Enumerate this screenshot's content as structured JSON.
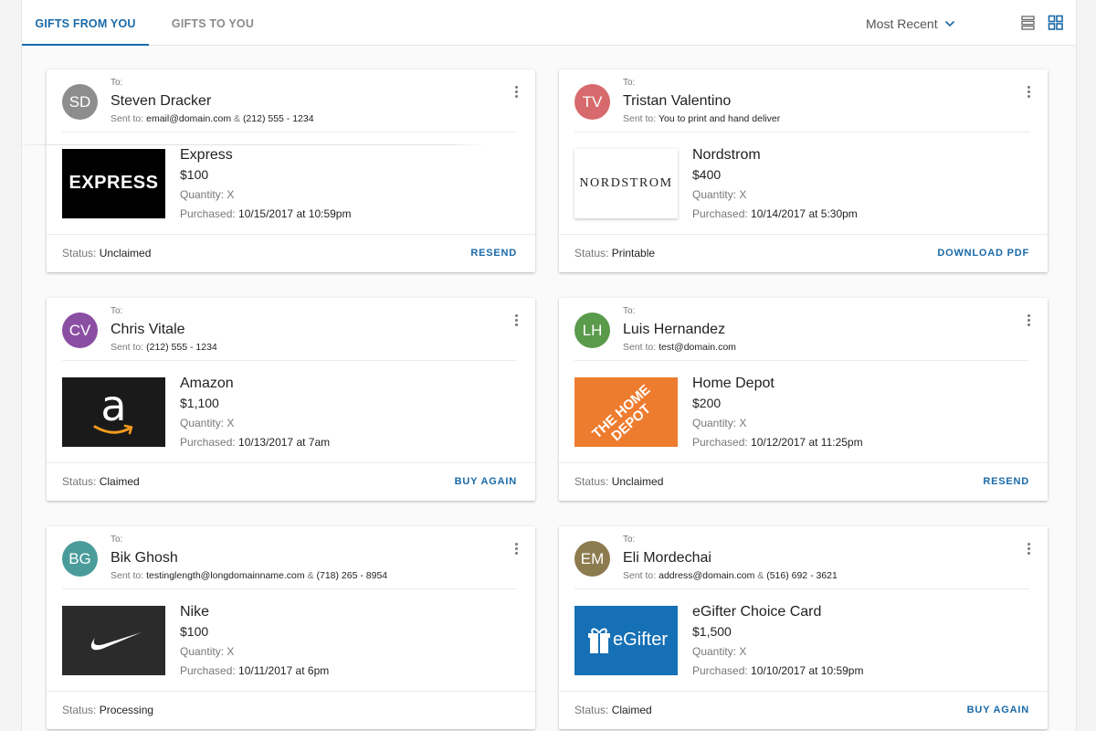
{
  "tabs": [
    {
      "label": "GIFTS FROM YOU",
      "active": true
    },
    {
      "label": "GIFTS TO YOU",
      "active": false
    }
  ],
  "sort": {
    "label": "Most Recent"
  },
  "view_toggle": {
    "list_icon": "list-view-icon",
    "grid_icon": "grid-view-icon",
    "active": "grid"
  },
  "colors": {
    "accent": "#1a6aa8"
  },
  "cards": [
    {
      "initials": "SD",
      "avatar_color": "#8d8d8d",
      "to_label": "To:",
      "name": "Steven Dracker",
      "sent_label": "Sent to:",
      "sent_value": "email@domain.com",
      "sent_sep": "&",
      "sent_value2": "(212) 555 - 1234",
      "brand": "Express",
      "amount": "$100",
      "qty_label": "Quantity:",
      "qty_value": "X",
      "purchased_label": "Purchased:",
      "purchased_value": "10/15/2017 at 10:59pm",
      "logo_text": "EXPRESS",
      "status_label": "Status:",
      "status_value": "Unclaimed",
      "action": "RESEND"
    },
    {
      "initials": "TV",
      "avatar_color": "#d76a6c",
      "to_label": "To:",
      "name": "Tristan Valentino",
      "sent_label": "Sent to:",
      "sent_value": "You to print and hand deliver",
      "sent_sep": "",
      "sent_value2": "",
      "brand": "Nordstrom",
      "amount": "$400",
      "qty_label": "Quantity:",
      "qty_value": "X",
      "purchased_label": "Purchased:",
      "purchased_value": "10/14/2017 at 5:30pm",
      "logo_text": "NORDSTROM",
      "status_label": "Status:",
      "status_value": "Printable",
      "action": "DOWNLOAD PDF"
    },
    {
      "initials": "CV",
      "avatar_color": "#8a4ea3",
      "to_label": "To:",
      "name": "Chris Vitale",
      "sent_label": "Sent to:",
      "sent_value": "(212) 555 - 1234",
      "sent_sep": "",
      "sent_value2": "",
      "brand": "Amazon",
      "amount": "$1,100",
      "qty_label": "Quantity:",
      "qty_value": "X",
      "purchased_label": "Purchased:",
      "purchased_value": "10/13/2017 at 7am",
      "logo_text": "a",
      "status_label": "Status:",
      "status_value": "Claimed",
      "action": "BUY AGAIN"
    },
    {
      "initials": "LH",
      "avatar_color": "#5a9a4b",
      "to_label": "To:",
      "name": "Luis Hernandez",
      "sent_label": "Sent to:",
      "sent_value": "test@domain.com",
      "sent_sep": "",
      "sent_value2": "",
      "brand": "Home Depot",
      "amount": "$200",
      "qty_label": "Quantity:",
      "qty_value": "X",
      "purchased_label": "Purchased:",
      "purchased_value": "10/12/2017 at 11:25pm",
      "logo_text": "THE HOME DEPOT",
      "status_label": "Status:",
      "status_value": "Unclaimed",
      "action": "RESEND"
    },
    {
      "initials": "BG",
      "avatar_color": "#4a9c9a",
      "to_label": "To:",
      "name": "Bik Ghosh",
      "sent_label": "Sent to:",
      "sent_value": "testinglength@longdomainname.com",
      "sent_sep": "&",
      "sent_value2": "(718) 265 - 8954",
      "brand": "Nike",
      "amount": "$100",
      "qty_label": "Quantity:",
      "qty_value": "X",
      "purchased_label": "Purchased:",
      "purchased_value": "10/11/2017 at 6pm",
      "logo_text": "",
      "status_label": "Status:",
      "status_value": "Processing",
      "action": ""
    },
    {
      "initials": "EM",
      "avatar_color": "#8c7b4f",
      "to_label": "To:",
      "name": "Eli Mordechai",
      "sent_label": "Sent to:",
      "sent_value": "address@domain.com",
      "sent_sep": "&",
      "sent_value2": "(516) 692 - 3621",
      "brand": "eGifter Choice Card",
      "amount": "$1,500",
      "qty_label": "Quantity:",
      "qty_value": "X",
      "purchased_label": "Purchased:",
      "purchased_value": "10/10/2017 at 10:59pm",
      "logo_text": "eGifter",
      "status_label": "Status:",
      "status_value": "Claimed",
      "action": "BUY AGAIN"
    }
  ]
}
